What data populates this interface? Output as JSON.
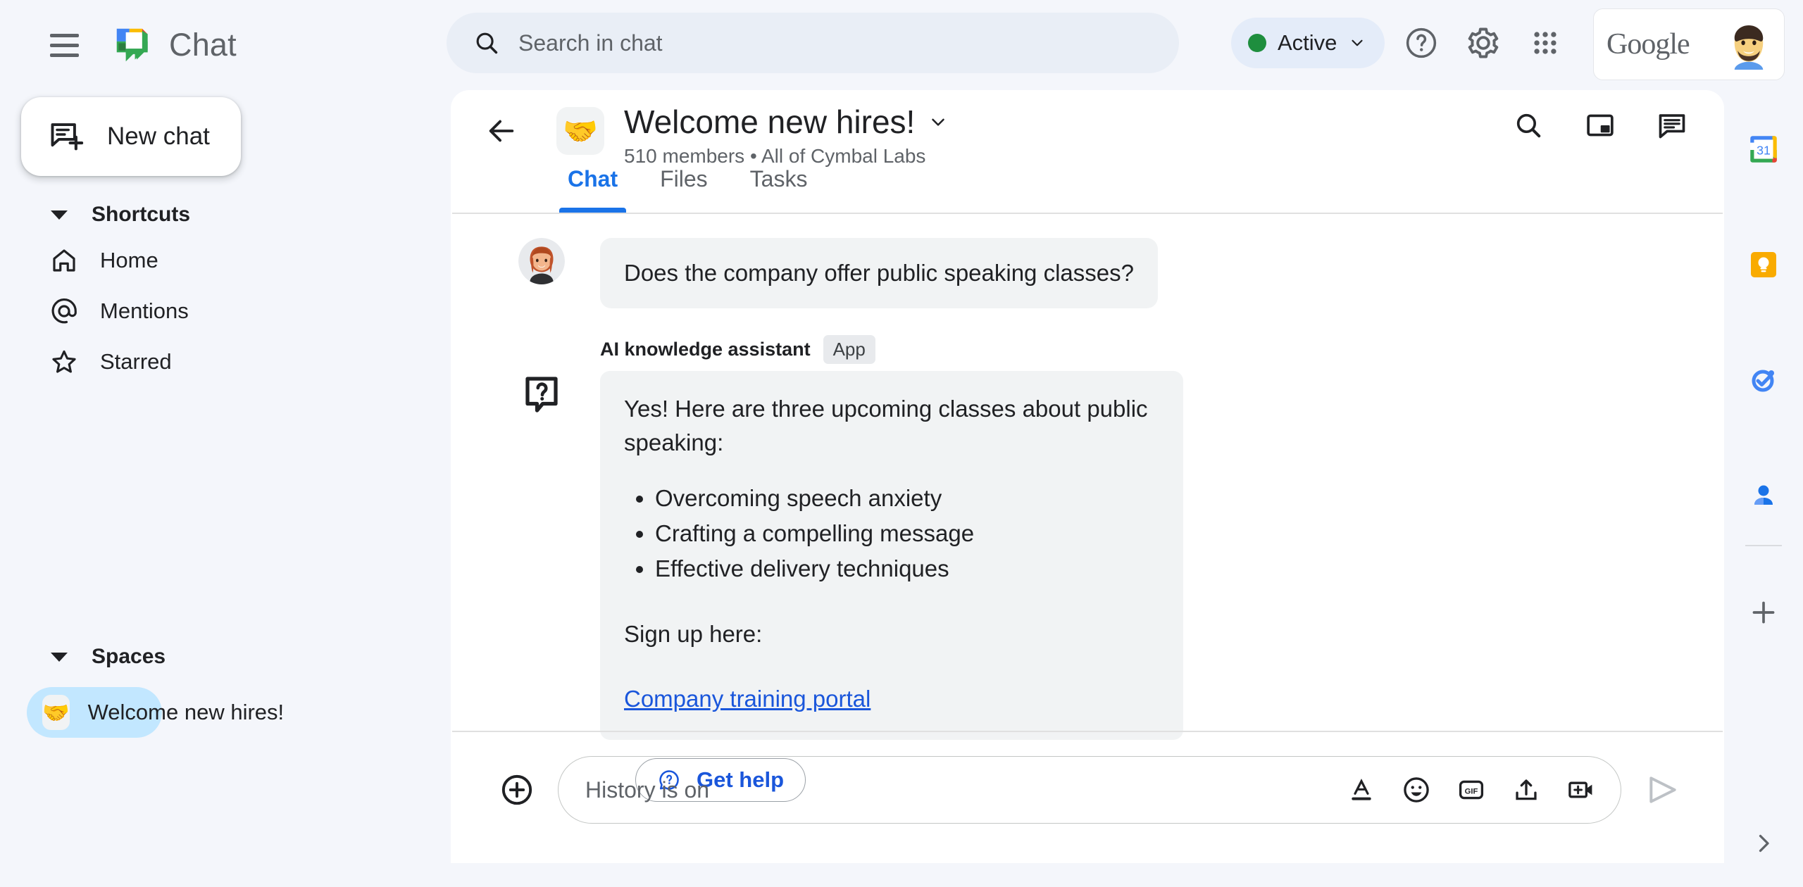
{
  "app": {
    "name": "Chat",
    "logo_icon": "google-chat-logo"
  },
  "topbar": {
    "menu_icon": "hamburger-menu-icon",
    "search": {
      "placeholder": "Search in chat",
      "icon": "search-icon"
    },
    "status": {
      "label": "Active",
      "dot_color": "#1e8e3e",
      "chevron_icon": "chevron-down-icon"
    },
    "help_icon": "help-circle-icon",
    "settings_icon": "gear-icon",
    "apps_icon": "apps-grid-icon",
    "account": {
      "brand": "Google",
      "avatar_icon": "user-avatar"
    }
  },
  "sidebar": {
    "new_chat": {
      "label": "New chat",
      "icon": "new-chat-icon"
    },
    "shortcuts": {
      "label": "Shortcuts",
      "items": [
        {
          "label": "Home",
          "icon": "home-icon"
        },
        {
          "label": "Mentions",
          "icon": "at-mention-icon"
        },
        {
          "label": "Starred",
          "icon": "star-icon"
        }
      ]
    },
    "spaces": {
      "label": "Spaces",
      "items": [
        {
          "label": "Welcome new hires!",
          "emoji": "🤝",
          "selected": true
        }
      ]
    }
  },
  "space": {
    "back_icon": "back-arrow-icon",
    "emoji": "🤝",
    "title": "Welcome new hires!",
    "title_chevron_icon": "chevron-down-icon",
    "subtitle": "510 members  •  All of Cymbal Labs",
    "actions": [
      {
        "icon": "search-icon"
      },
      {
        "icon": "picture-in-picture-icon"
      },
      {
        "icon": "chat-pane-icon"
      }
    ],
    "tabs": [
      {
        "label": "Chat",
        "active": true
      },
      {
        "label": "Files",
        "active": false
      },
      {
        "label": "Tasks",
        "active": false
      }
    ]
  },
  "messages": {
    "user_message": {
      "avatar_icon": "user-avatar",
      "text": "Does the company offer public speaking classes?"
    },
    "app_message": {
      "sender": "AI knowledge assistant",
      "badge": "App",
      "avatar_icon": "question-bubble-icon",
      "intro": "Yes! Here are three upcoming classes about public speaking:",
      "bullets": [
        "Overcoming speech anxiety",
        "Crafting a compelling message",
        "Effective delivery techniques"
      ],
      "signup_text": "Sign up here:",
      "link_text": "Company training portal"
    },
    "get_help": {
      "label": "Get help",
      "icon": "help-bubble-icon"
    }
  },
  "composer": {
    "plus_icon": "add-circle-icon",
    "placeholder": "History is on",
    "tools": [
      {
        "icon": "format-text-icon"
      },
      {
        "icon": "emoji-icon"
      },
      {
        "icon": "gif-icon"
      },
      {
        "icon": "upload-icon"
      },
      {
        "icon": "add-video-icon"
      }
    ],
    "send_icon": "send-icon"
  },
  "right_rail": {
    "items": [
      {
        "icon": "google-calendar-icon",
        "label": "31"
      },
      {
        "icon": "google-keep-icon"
      },
      {
        "icon": "google-tasks-icon"
      },
      {
        "icon": "google-contacts-icon"
      }
    ],
    "add_icon": "plus-icon",
    "expand_icon": "chevron-right-icon"
  },
  "colors": {
    "accent_blue": "#1a73e8",
    "link_blue": "#1a56db",
    "selected_space": "#c2e7ff",
    "bubble_gray": "#f1f3f4",
    "page_bg": "#f4f6fb"
  }
}
